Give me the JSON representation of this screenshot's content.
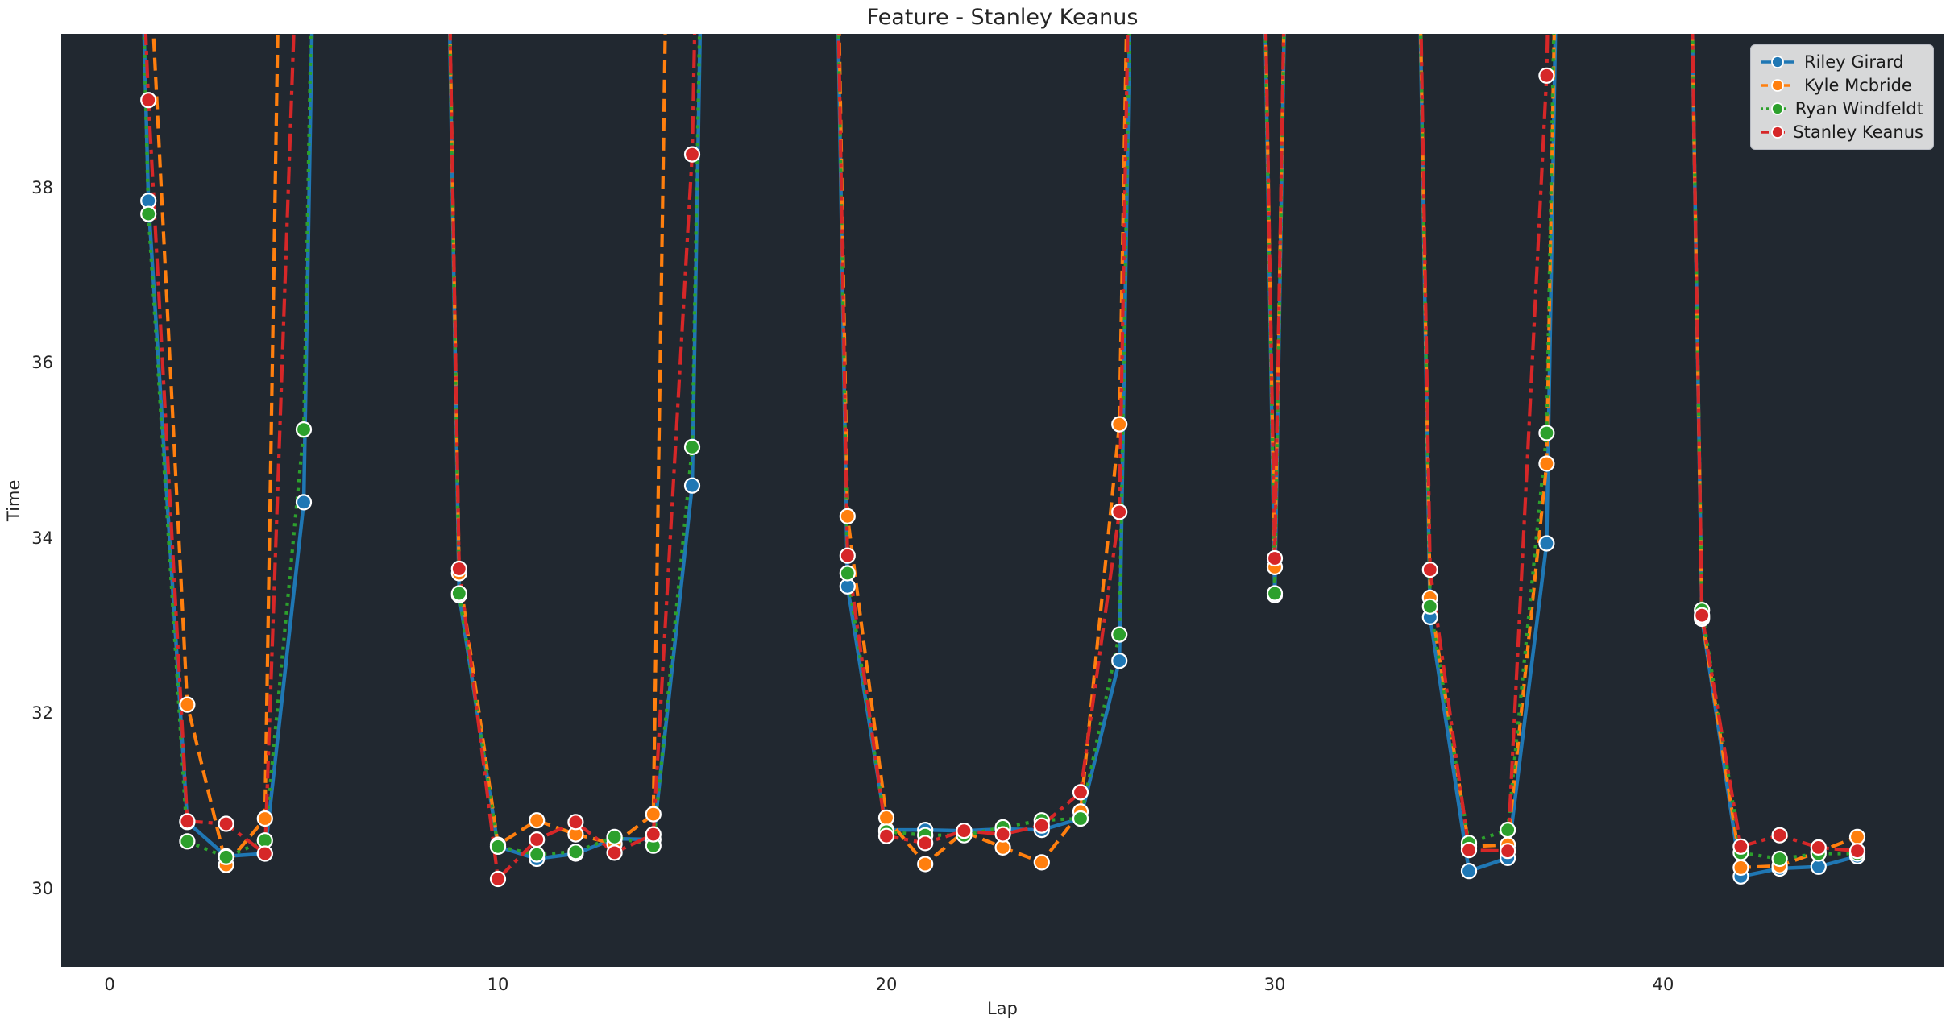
{
  "title": "Feature - Stanley Keanus",
  "colors": {
    "figure_background": "#ffffff",
    "plot_background": "#212830",
    "text": "#262626",
    "legend_background": "#d5d7dc",
    "marker_edge": "#ffffff"
  },
  "legend": {
    "position": "upper right",
    "entries": [
      "Riley Girard",
      "Kyle Mcbride",
      "Ryan Windfeldt",
      "Stanley Keanus"
    ]
  },
  "chart_data": {
    "type": "line",
    "title": "Feature - Stanley Keanus",
    "xlabel": "Lap",
    "ylabel": "Time",
    "x_ticks": [
      0,
      10,
      20,
      30,
      40
    ],
    "y_ticks": [
      30,
      32,
      34,
      36,
      38
    ],
    "xlim": [
      -1.245,
      47.22
    ],
    "ylim": [
      29.108,
      39.756
    ],
    "grid": false,
    "legend_position": "upper right",
    "note": "values above ~39.76 are caution/pit laps drawn off the top of the axes",
    "x": [
      0,
      1,
      2,
      3,
      4,
      5,
      6,
      7,
      8,
      9,
      10,
      11,
      12,
      13,
      14,
      15,
      16,
      17,
      18,
      19,
      20,
      21,
      22,
      23,
      24,
      25,
      26,
      27,
      28,
      29,
      30,
      31,
      32,
      33,
      34,
      35,
      36,
      37,
      38,
      39,
      40,
      41,
      42,
      43,
      44,
      45
    ],
    "series": [
      {
        "name": "Riley Girard",
        "color": "#1f77b4",
        "linestyle": "solid",
        "values": [
          55,
          37.85,
          30.76,
          30.37,
          30.4,
          34.41,
          60,
          60,
          60,
          33.35,
          30.48,
          30.34,
          30.4,
          30.57,
          30.56,
          34.6,
          60,
          60,
          60,
          33.45,
          30.67,
          30.67,
          30.66,
          30.68,
          30.67,
          30.8,
          32.6,
          60,
          60,
          60,
          33.35,
          60,
          60,
          60,
          33.1,
          30.2,
          30.35,
          33.94,
          60,
          60,
          60,
          33.08,
          30.14,
          30.23,
          30.25,
          30.37
        ]
      },
      {
        "name": "Kyle Mcbride",
        "color": "#ff7f0e",
        "linestyle": "dashed",
        "values": [
          60,
          40.9,
          32.1,
          30.27,
          30.8,
          58,
          60,
          60,
          60,
          33.6,
          30.5,
          30.78,
          30.62,
          30.51,
          30.85,
          60,
          60,
          60,
          60,
          34.25,
          30.81,
          30.28,
          30.65,
          30.47,
          30.3,
          30.88,
          35.3,
          60,
          60,
          60,
          33.67,
          60,
          60,
          60,
          33.32,
          30.48,
          30.5,
          34.85,
          60,
          60,
          60,
          33.1,
          30.24,
          30.26,
          30.42,
          30.59
        ]
      },
      {
        "name": "Ryan Windfeldt",
        "color": "#2ca02c",
        "linestyle": "dotted",
        "values": [
          56,
          37.7,
          30.54,
          30.36,
          30.55,
          35.24,
          60,
          60,
          60,
          33.37,
          30.48,
          30.39,
          30.42,
          30.59,
          30.49,
          35.04,
          60,
          60,
          60,
          33.6,
          30.65,
          30.61,
          30.61,
          30.7,
          30.78,
          30.8,
          32.9,
          60,
          60,
          60,
          33.37,
          60,
          60,
          60,
          33.22,
          30.52,
          30.67,
          35.2,
          60,
          60,
          60,
          33.18,
          30.41,
          30.34,
          30.4,
          30.4
        ]
      },
      {
        "name": "Stanley Keanus",
        "color": "#d62728",
        "linestyle": "dashdot",
        "values": [
          50,
          39.0,
          30.77,
          30.74,
          30.4,
          43,
          60,
          60,
          60,
          33.65,
          30.11,
          30.56,
          30.76,
          30.41,
          30.62,
          38.38,
          60,
          60,
          60,
          33.8,
          30.6,
          30.52,
          30.66,
          30.62,
          30.72,
          31.1,
          34.3,
          60,
          60,
          60,
          33.77,
          60,
          60,
          60,
          33.64,
          30.44,
          30.43,
          39.28,
          60,
          60,
          60,
          33.12,
          30.48,
          30.61,
          30.47,
          30.43
        ]
      }
    ]
  }
}
